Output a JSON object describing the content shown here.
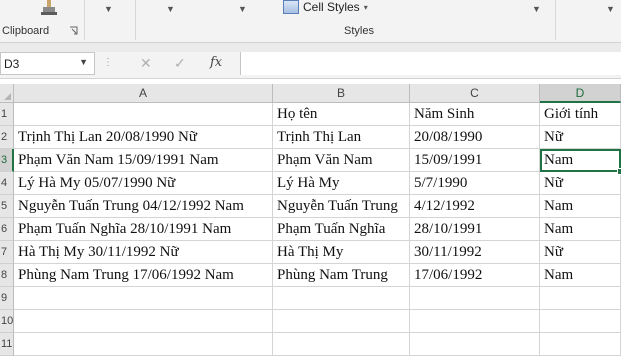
{
  "ribbon": {
    "clipboard_label": "Clipboard",
    "cell_styles_label": "Cell Styles",
    "styles_label": "Styles"
  },
  "formula_bar": {
    "name_box": "D3",
    "cancel_icon": "✕",
    "enter_icon": "✓",
    "fx_label": "fx",
    "formula_value": ""
  },
  "sheet": {
    "columns": [
      "A",
      "B",
      "C",
      "D"
    ],
    "active_column": "D",
    "row_numbers": [
      "1",
      "2",
      "3",
      "4",
      "5",
      "6",
      "7",
      "8",
      "9",
      "10",
      "11"
    ],
    "active_row": "3",
    "rows": [
      [
        "",
        "Họ tên",
        "Năm Sinh",
        "Giới tính"
      ],
      [
        "Trịnh Thị Lan 20/08/1990 Nữ",
        "Trịnh Thị Lan",
        "20/08/1990",
        "Nữ"
      ],
      [
        "Phạm Văn Nam 15/09/1991 Nam",
        "Phạm Văn Nam",
        "15/09/1991",
        "Nam"
      ],
      [
        "Lý Hà My 05/07/1990 Nữ",
        "Lý Hà My",
        "5/7/1990",
        "Nữ"
      ],
      [
        "Nguyễn Tuấn Trung 04/12/1992 Nam",
        "Nguyễn Tuấn Trung",
        "4/12/1992",
        "Nam"
      ],
      [
        "Phạm Tuấn Nghĩa 28/10/1991 Nam",
        "Phạm Tuấn Nghĩa",
        "28/10/1991",
        "Nam"
      ],
      [
        "Hà Thị My 30/11/1992 Nữ",
        "Hà Thị My",
        "30/11/1992",
        "Nữ"
      ],
      [
        "Phùng Nam Trung 17/06/1992 Nam",
        "Phùng Nam Trung",
        "17/06/1992",
        "Nam"
      ],
      [
        "",
        "",
        "",
        ""
      ],
      [
        "",
        "",
        "",
        ""
      ],
      [
        "",
        "",
        "",
        ""
      ]
    ],
    "selected_cell": "D3",
    "colors": {
      "accent": "#217346",
      "header_bg": "#e6e6e6",
      "gridline": "#d4d4d4"
    }
  }
}
